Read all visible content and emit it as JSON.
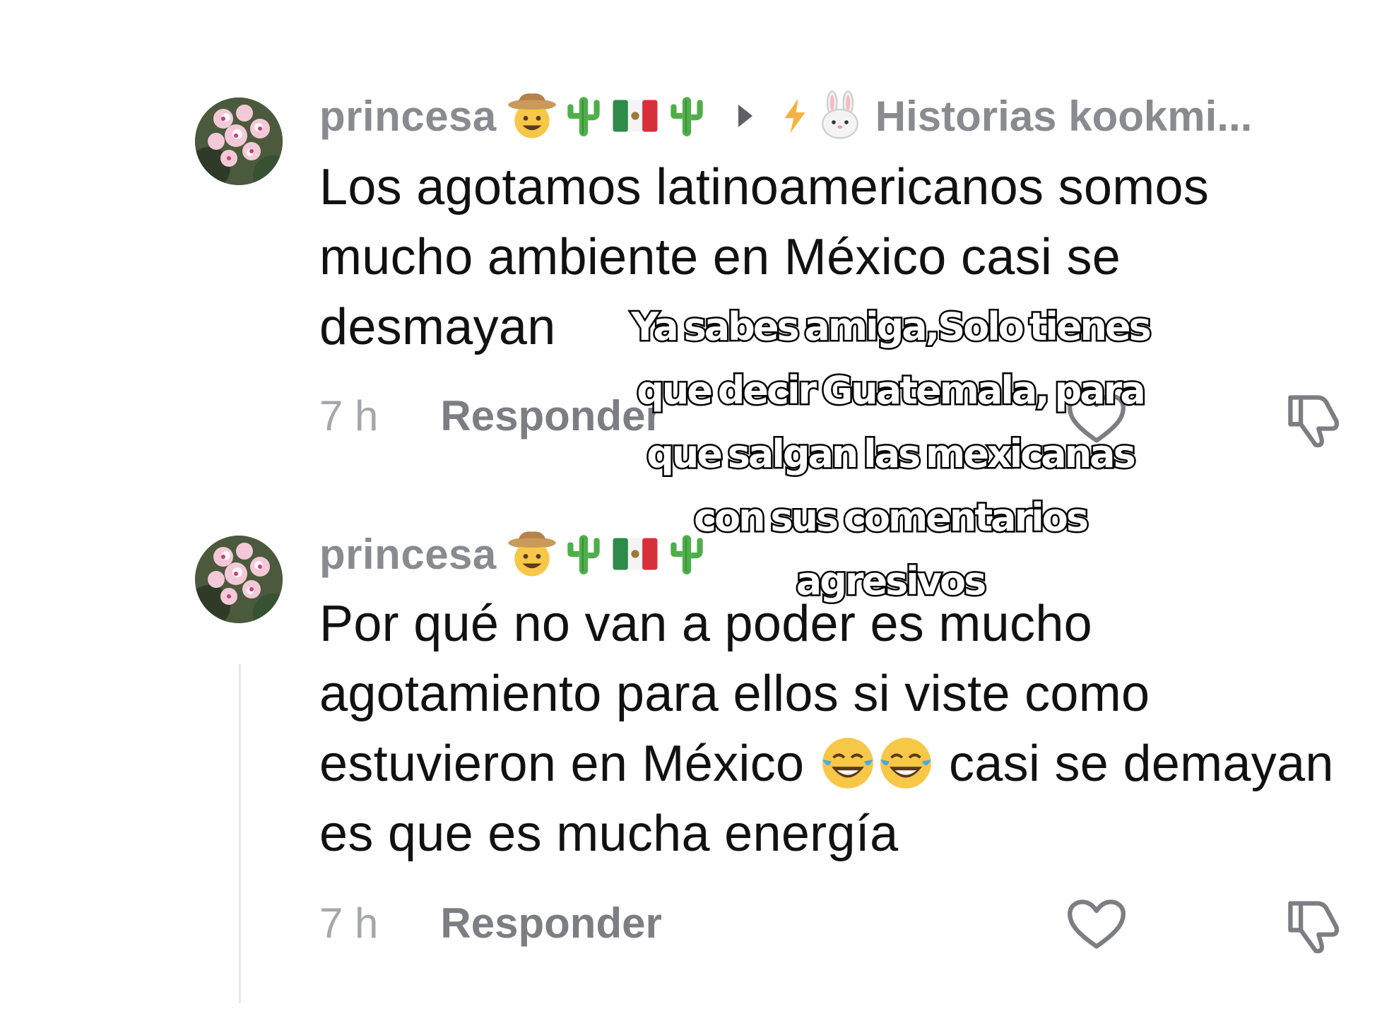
{
  "comments": [
    {
      "username": "princesa",
      "user_emojis": [
        "cowboy-face-emoji",
        "cactus-emoji",
        "mexico-flag-emoji",
        "cactus-emoji"
      ],
      "reply_to": {
        "emojis": [
          "lightning-emoji",
          "rabbit-face-emoji"
        ],
        "name": "Historias kookmi..."
      },
      "text": "Los agotamos latinoamericanos somos mucho ambiente en México casi se desmayan",
      "time": "7 h",
      "reply_label": "Responder"
    },
    {
      "username": "princesa",
      "user_emojis": [
        "cowboy-face-emoji",
        "cactus-emoji",
        "mexico-flag-emoji",
        "cactus-emoji"
      ],
      "text_before_emoji": "Por qué no van a poder es mucho agotamiento para ellos si viste como estuvieron en México ",
      "text_emojis": [
        "face-with-tears-of-joy-emoji",
        "face-with-tears-of-joy-emoji"
      ],
      "text_after_emoji": " casi se demayan es que es mucha energía",
      "time": "7 h",
      "reply_label": "Responder"
    }
  ],
  "overlay_caption": "Ya sabes amiga,Solo tienes que decir Guatemala, para que salgan las mexicanas con sus comentarios agresivos",
  "colors": {
    "username": "#8a8b91",
    "body_text": "#111111",
    "meta_time": "#a6a7ab",
    "reply_button": "#7d7e84",
    "icon_stroke": "#7d7e84",
    "thread_line": "#e6e6e8"
  }
}
